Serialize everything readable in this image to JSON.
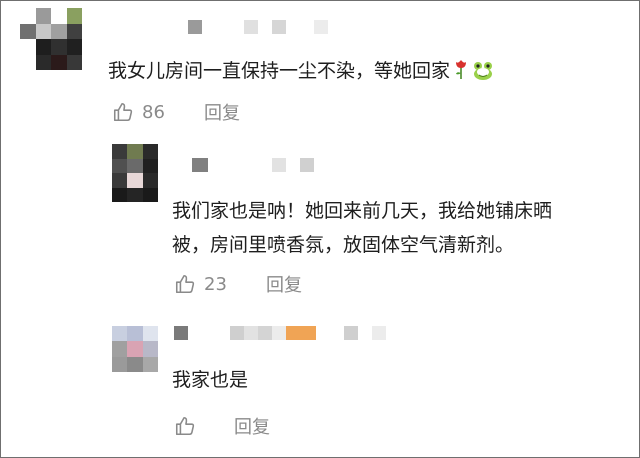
{
  "comments": [
    {
      "text": "我女儿房间一直保持一尘不染，等她回家",
      "emojis": [
        "rose-emoji",
        "frog-emoji"
      ],
      "likes": "86",
      "reply_label": "回复"
    },
    {
      "text_line1": "我们家也是呐！她回来前几天，我给她铺床晒",
      "text_line2": "被，房间里喷香氛，放固体空气清新剂。",
      "likes": "23",
      "reply_label": "回复"
    },
    {
      "text": "我家也是",
      "likes": "",
      "reply_label": "回复"
    }
  ],
  "colors": {
    "text": "#1e1e1e",
    "meta": "#8a8a8a",
    "name_accent": "#f0a455"
  }
}
